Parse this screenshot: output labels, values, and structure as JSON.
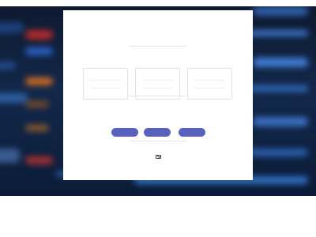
{
  "colors": {
    "accent": "#5862bd",
    "background_dark": "#0e1a30",
    "card": "#ffffff"
  },
  "icons": {
    "footer_icon": "mail-icon"
  },
  "buttons": [
    {
      "label": ""
    },
    {
      "label": ""
    },
    {
      "label": ""
    }
  ]
}
